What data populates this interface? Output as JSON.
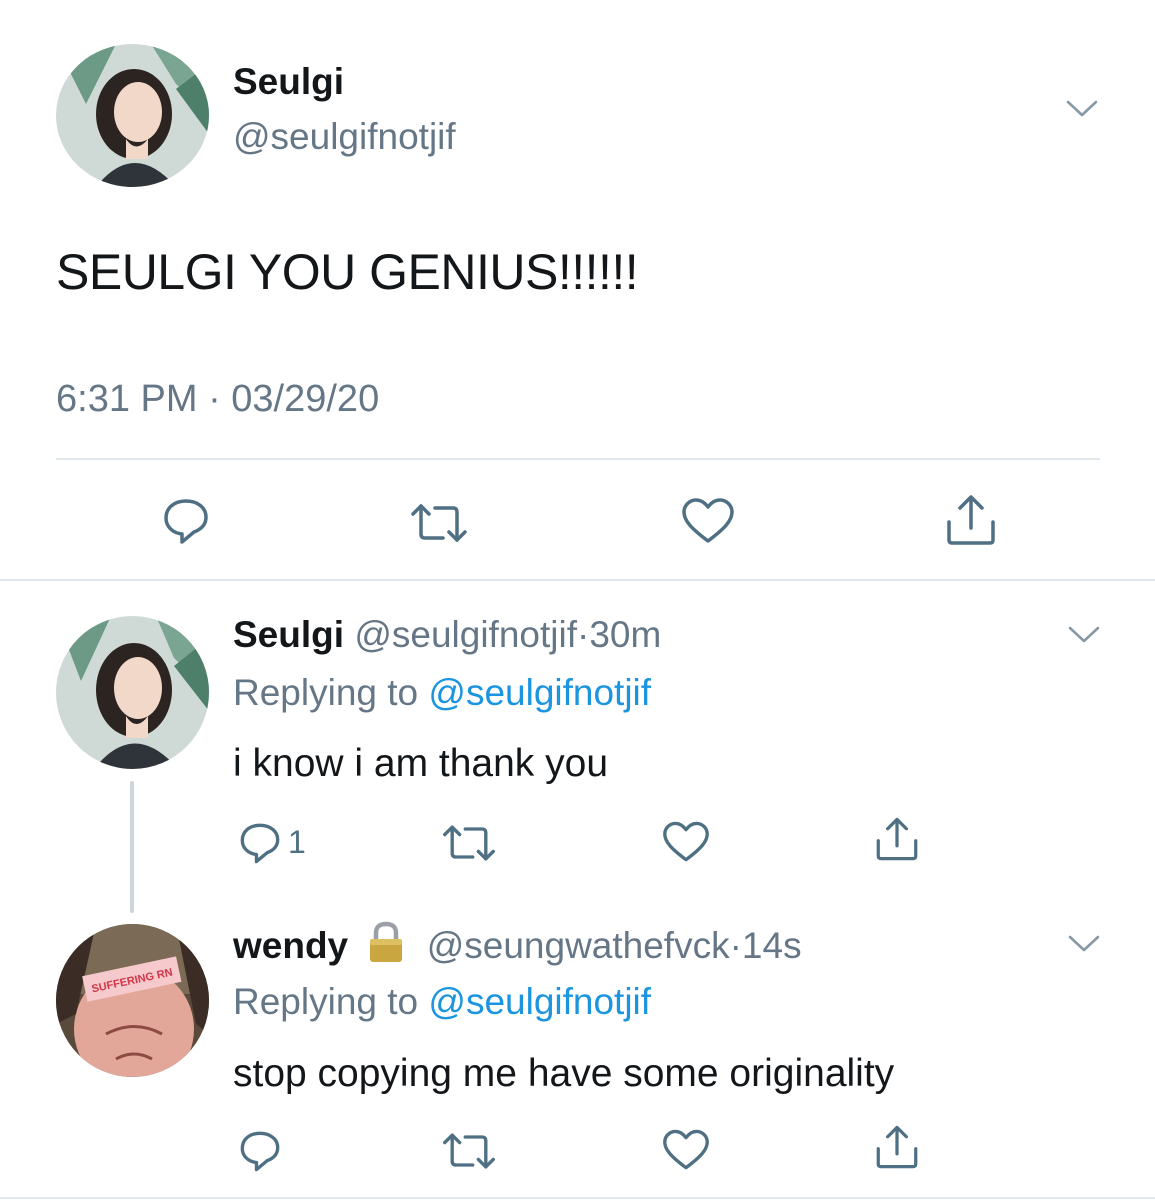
{
  "main_tweet": {
    "display_name": "Seulgi",
    "handle": "@seulgifnotjif",
    "text": "SEULGI YOU GENIUS!!!!!!",
    "timestamp": "6:31 PM · 03/29/20",
    "actions": [
      "reply-icon",
      "retweet-icon",
      "like-icon",
      "share-icon"
    ]
  },
  "replies": [
    {
      "display_name": "Seulgi",
      "handle": "@seulgifnotjif",
      "sep": "·",
      "time": "30m",
      "replying_prefix": "Replying to",
      "replying_to": "@seulgifnotjif",
      "text": "i know i am thank you",
      "reply_count": "1"
    },
    {
      "display_name": "wendy",
      "locked": true,
      "handle": "@seungwathefvck",
      "sep": "·",
      "time": "14s",
      "replying_prefix": "Replying to",
      "replying_to": "@seulgifnotjif",
      "text": "stop copying me have some originality",
      "avatar_sign": "SUFFERING RN"
    }
  ],
  "colors": {
    "text": "#14171a",
    "secondary": "#657786",
    "link": "#1b95e0",
    "icon": "#4f6f83",
    "divider": "#e1e8ed"
  }
}
